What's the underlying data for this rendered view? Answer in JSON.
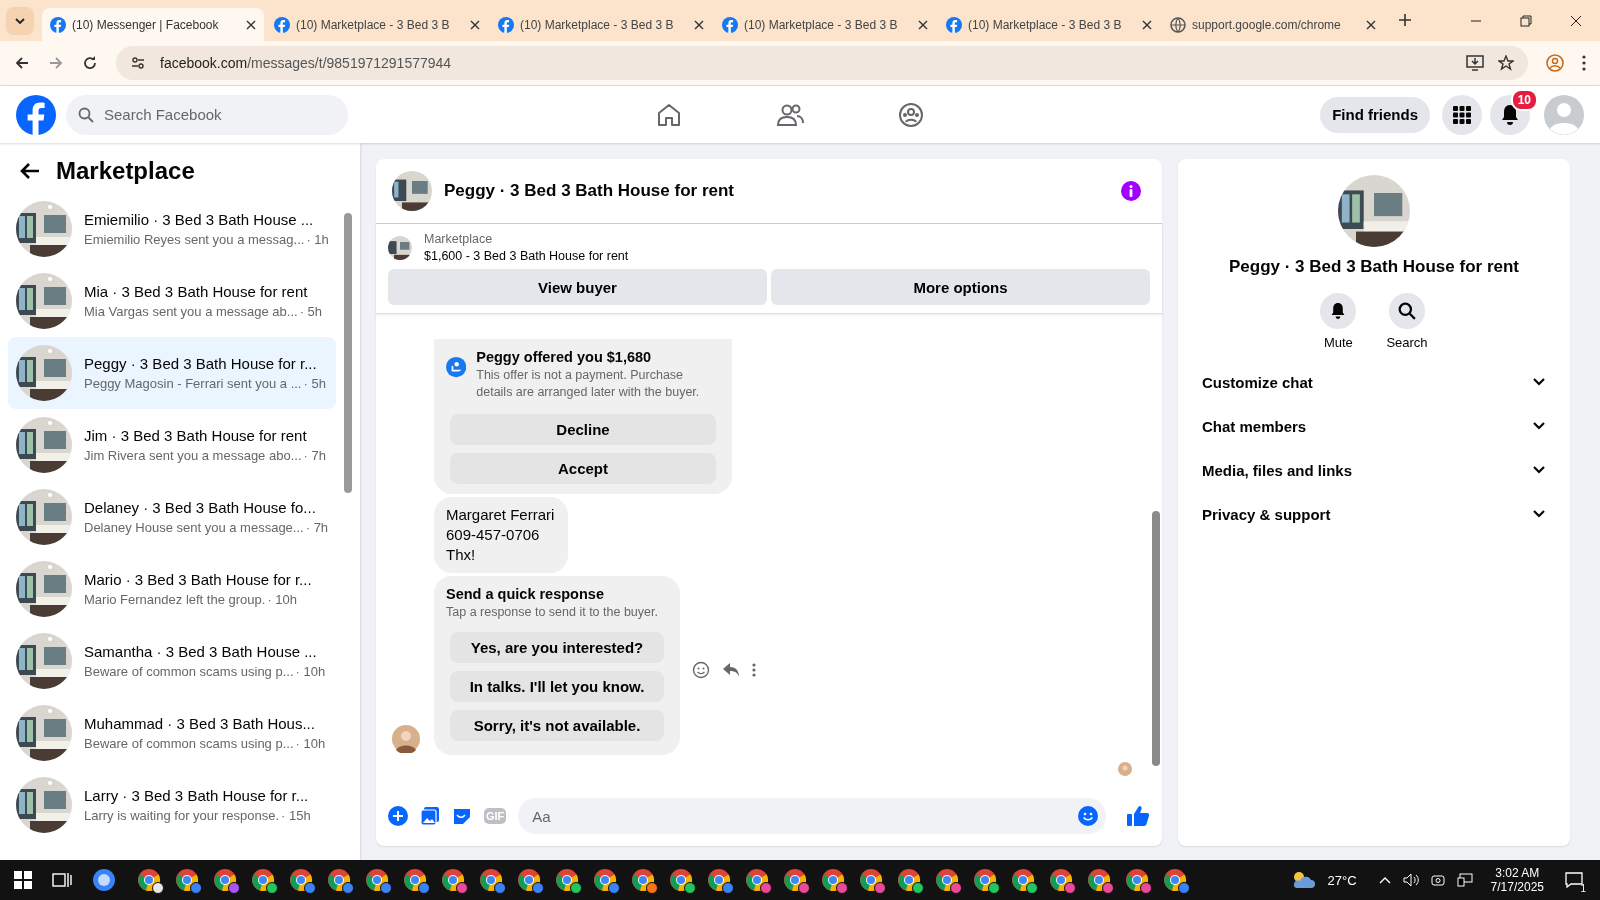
{
  "browser": {
    "tabs": [
      {
        "title": "(10) Messenger | Facebook",
        "kind": "facebook",
        "selected": true
      },
      {
        "title": "(10) Marketplace - 3 Bed 3 B",
        "kind": "facebook",
        "selected": false
      },
      {
        "title": "(10) Marketplace - 3 Bed 3 B",
        "kind": "facebook",
        "selected": false
      },
      {
        "title": "(10) Marketplace - 3 Bed 3 B",
        "kind": "facebook",
        "selected": false
      },
      {
        "title": "(10) Marketplace - 3 Bed 3 B",
        "kind": "facebook",
        "selected": false
      },
      {
        "title": "support.google.com/chrome",
        "kind": "globe",
        "selected": false
      }
    ],
    "url_host": "facebook.com",
    "url_path": "/messages/t/9851971291577944"
  },
  "header": {
    "search_placeholder": "Search Facebook",
    "find_friends": "Find friends",
    "notification_count": "10"
  },
  "sidebar": {
    "title": "Marketplace",
    "items": [
      {
        "title": "Emiemilio · 3 Bed 3 Bath House ...",
        "preview": "Emiemilio Reyes sent you a messag...",
        "time": "· 1h",
        "selected": false
      },
      {
        "title": "Mia · 3 Bed 3 Bath House for rent",
        "preview": "Mia Vargas sent you a message ab...",
        "time": "· 5h",
        "selected": false
      },
      {
        "title": "Peggy · 3 Bed 3 Bath House for r...",
        "preview": "Peggy Magosin - Ferrari sent you a ...",
        "time": "· 5h",
        "selected": true
      },
      {
        "title": "Jim · 3 Bed 3 Bath House for rent",
        "preview": "Jim Rivera sent you a message abo...",
        "time": "· 7h",
        "selected": false
      },
      {
        "title": "Delaney · 3 Bed 3 Bath House fo...",
        "preview": "Delaney House sent you a message...",
        "time": "· 7h",
        "selected": false
      },
      {
        "title": "Mario · 3 Bed 3 Bath House for r...",
        "preview": "Mario Fernandez left the group.",
        "time": "· 10h",
        "selected": false
      },
      {
        "title": "Samantha · 3 Bed 3 Bath House ...",
        "preview": "Beware of common scams using p...",
        "time": "· 10h",
        "selected": false
      },
      {
        "title": "Muhammad · 3 Bed 3 Bath Hous...",
        "preview": "Beware of common scams using p...",
        "time": "· 10h",
        "selected": false
      },
      {
        "title": "Larry · 3 Bed 3 Bath House for r...",
        "preview": "Larry is waiting for your response.",
        "time": "· 15h",
        "selected": false
      }
    ]
  },
  "chat": {
    "title": "Peggy · 3 Bed 3 Bath House for rent",
    "listing_label": "Marketplace",
    "listing": "$1,600 - 3 Bed 3 Bath House for rent",
    "buttons": [
      "View buyer",
      "More options"
    ],
    "offer": {
      "title": "Peggy offered you $1,680",
      "note": "This offer is not a payment. Purchase details are arranged later with the buyer.",
      "actions": [
        "Decline",
        "Accept"
      ]
    },
    "message_lines": [
      "Margaret Ferrari",
      "609-457-0706",
      "Thx!"
    ],
    "quick": {
      "title": "Send a quick response",
      "subtitle": "Tap a response to send it to the buyer.",
      "responses": [
        "Yes, are you interested?",
        "In talks. I'll let you know.",
        "Sorry, it's not available."
      ]
    },
    "composer": {
      "placeholder": "Aa",
      "gif": "GIF"
    }
  },
  "details": {
    "title": "Peggy · 3 Bed 3 Bath House for rent",
    "actions": [
      "Mute",
      "Search"
    ],
    "sections": [
      {
        "label": "Customize chat",
        "expanded": false
      },
      {
        "label": "Chat members",
        "expanded": false
      },
      {
        "label": "Media, files and links",
        "expanded": false
      },
      {
        "label": "Privacy & support",
        "expanded": false
      }
    ]
  },
  "taskbar": {
    "weather": "27°C",
    "time": "3:02 AM",
    "date": "7/17/2025",
    "notifications": "1",
    "apps": [
      {
        "color": "#e8e8e8"
      },
      {
        "color": "#3b82f6"
      },
      {
        "color": "#a855f7"
      },
      {
        "color": "#22c55e"
      },
      {
        "color": "#3b82f6"
      },
      {
        "color": "#3b82f6"
      },
      {
        "color": "#3b82f6"
      },
      {
        "color": "#3b82f6"
      },
      {
        "color": "#ec4899"
      },
      {
        "color": "#3b82f6"
      },
      {
        "color": "#3b82f6"
      },
      {
        "color": "#22c55e"
      },
      {
        "color": "#3b82f6"
      },
      {
        "color": "#f97316"
      },
      {
        "color": "#22c55e"
      },
      {
        "color": "#3b82f6"
      },
      {
        "color": "#ec4899"
      },
      {
        "color": "#ec4899"
      },
      {
        "color": "#ec4899"
      },
      {
        "color": "#ec4899"
      },
      {
        "color": "#22c55e"
      },
      {
        "color": "#ec4899"
      },
      {
        "color": "#22c55e"
      },
      {
        "color": "#22c55e"
      },
      {
        "color": "#ec4899"
      },
      {
        "color": "#ec4899"
      },
      {
        "color": "#ec4899"
      },
      {
        "color": "#3b82f6"
      }
    ]
  }
}
